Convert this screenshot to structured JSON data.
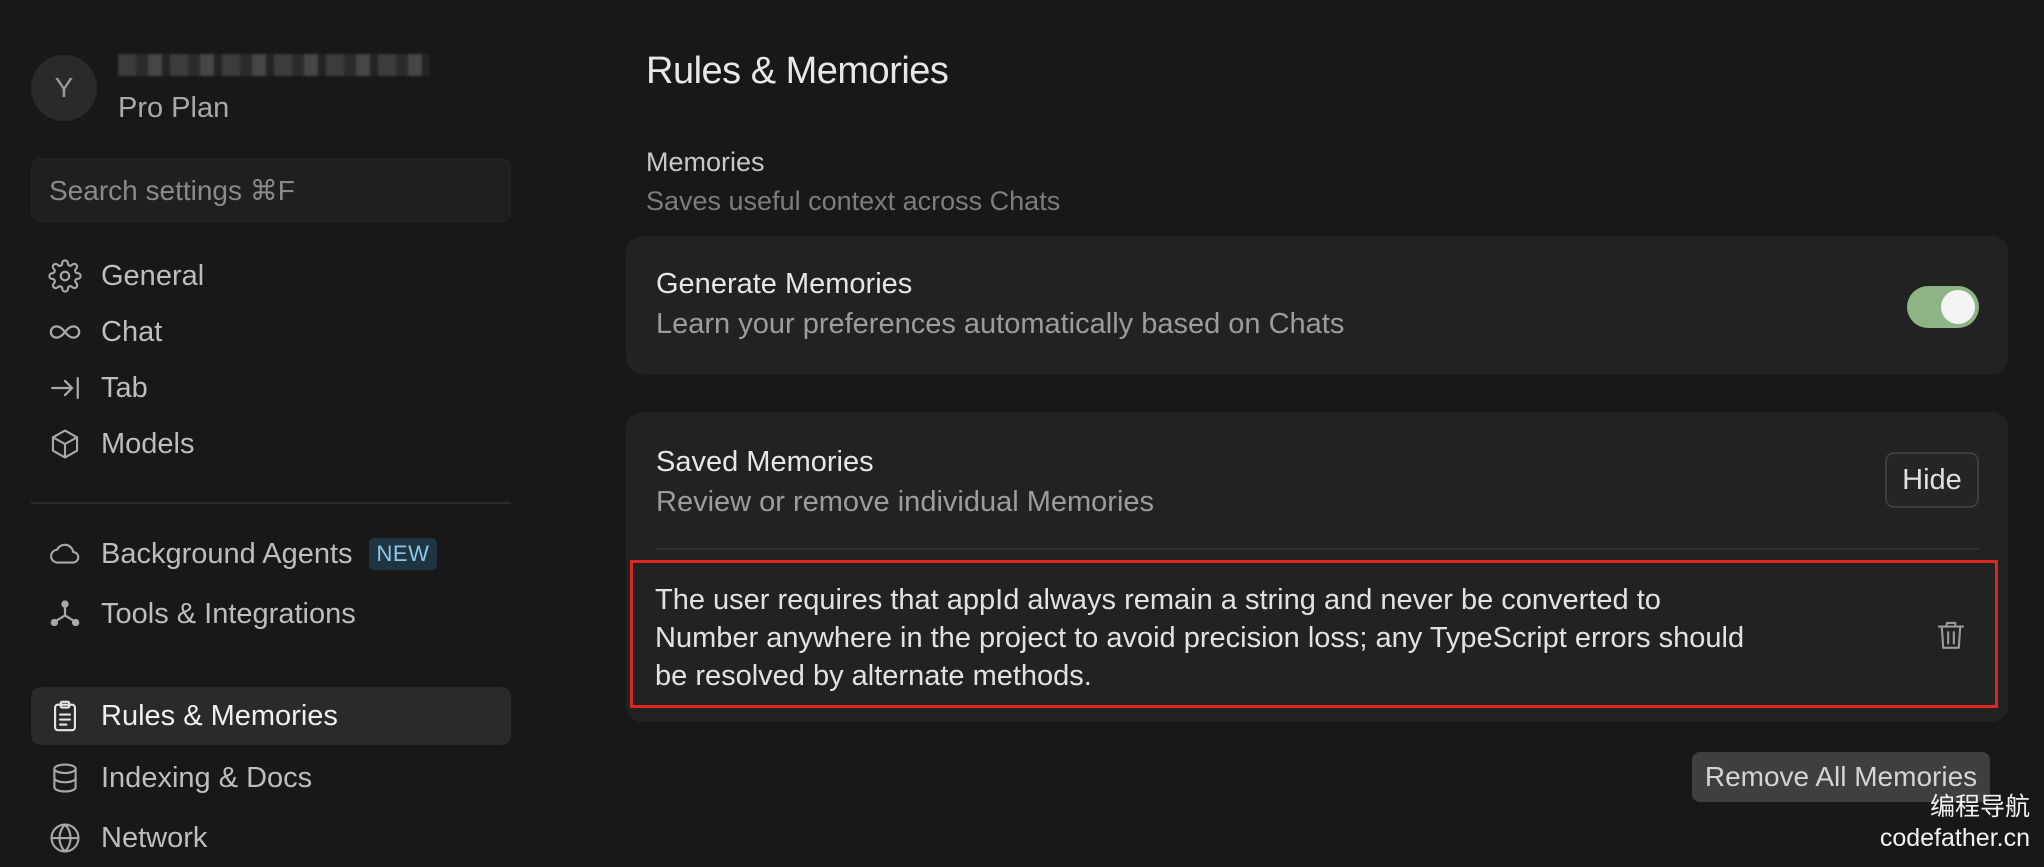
{
  "sidebar": {
    "user": {
      "avatar_initial": "Y",
      "plan": "Pro Plan"
    },
    "search_placeholder": "Search settings ⌘F",
    "items_group1": [
      {
        "label": "General",
        "icon": "gear-icon"
      },
      {
        "label": "Chat",
        "icon": "infinity-icon"
      },
      {
        "label": "Tab",
        "icon": "arrow-to-line-icon"
      },
      {
        "label": "Models",
        "icon": "cube-icon"
      }
    ],
    "items_group2": [
      {
        "label": "Background Agents",
        "icon": "cloud-icon",
        "badge": "NEW"
      },
      {
        "label": "Tools & Integrations",
        "icon": "network-nodes-icon"
      }
    ],
    "items_group3": [
      {
        "label": "Rules & Memories",
        "icon": "clipboard-icon",
        "active": true
      },
      {
        "label": "Indexing & Docs",
        "icon": "database-icon"
      },
      {
        "label": "Network",
        "icon": "globe-icon"
      }
    ]
  },
  "main": {
    "title": "Rules & Memories",
    "memories_section": {
      "title": "Memories",
      "subtitle": "Saves useful context across Chats"
    },
    "generate_card": {
      "title": "Generate Memories",
      "subtitle": "Learn your preferences automatically based on Chats",
      "toggle_on": true,
      "toggle_color": "#8eb485"
    },
    "saved_card": {
      "title": "Saved Memories",
      "subtitle": "Review or remove individual Memories",
      "hide_label": "Hide",
      "memories": [
        {
          "lines": [
            "The user requires that appId always remain a string and never be converted to",
            "Number anywhere in the project to avoid precision loss; any TypeScript errors should",
            "be resolved by alternate methods."
          ],
          "highlight_color": "#d9291e"
        }
      ]
    },
    "remove_all_label": "Remove All Memories"
  },
  "watermark": {
    "line1": "编程导航",
    "line2": "codefather.cn"
  }
}
